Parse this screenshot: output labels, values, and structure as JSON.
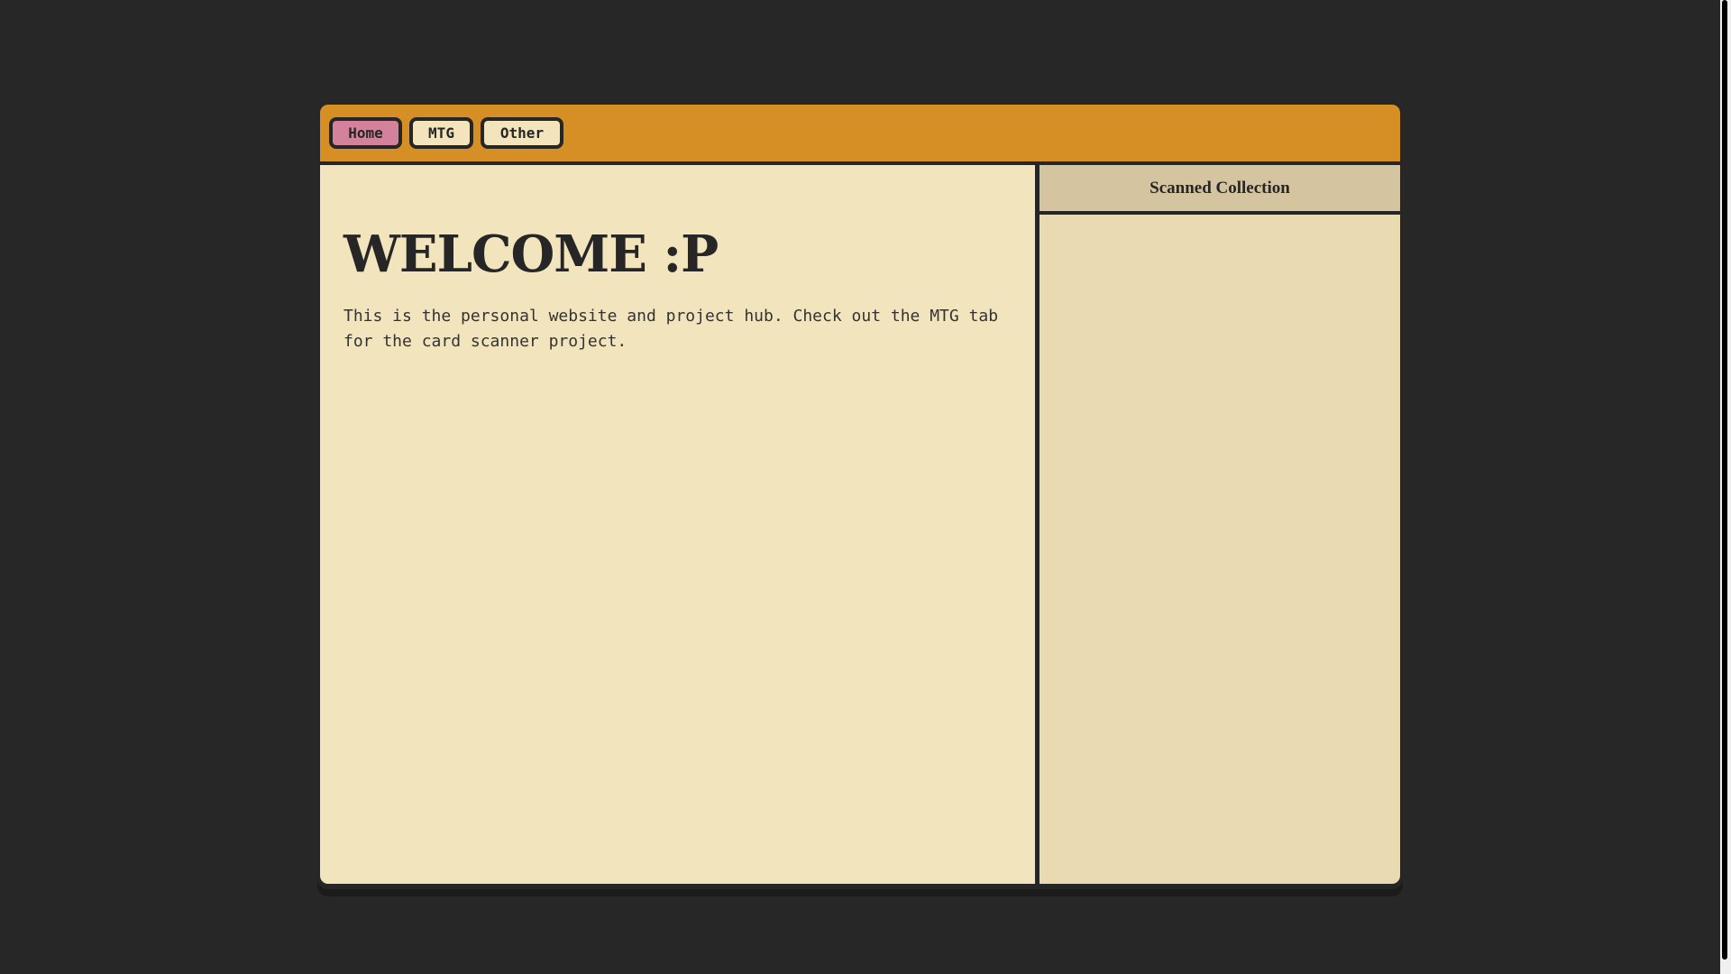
{
  "nav": {
    "tabs": [
      {
        "label": "Home",
        "active": true
      },
      {
        "label": "MTG",
        "active": false
      },
      {
        "label": "Other",
        "active": false
      }
    ]
  },
  "main": {
    "heading": "WELCOME :P",
    "body": "This is the personal website and project hub. Check out the MTG tab for the card scanner project."
  },
  "sidebar": {
    "title": "Scanned Collection",
    "items": []
  },
  "colors": {
    "background": "#272727",
    "titlebar": "#d68f24",
    "active_tab": "#d4829b",
    "inactive_tab": "#f3e4bb",
    "main_panel": "#f2e4bd",
    "sidebar_panel": "#e9dab1",
    "sidebar_header": "#d5c4a0",
    "border": "#262626"
  }
}
